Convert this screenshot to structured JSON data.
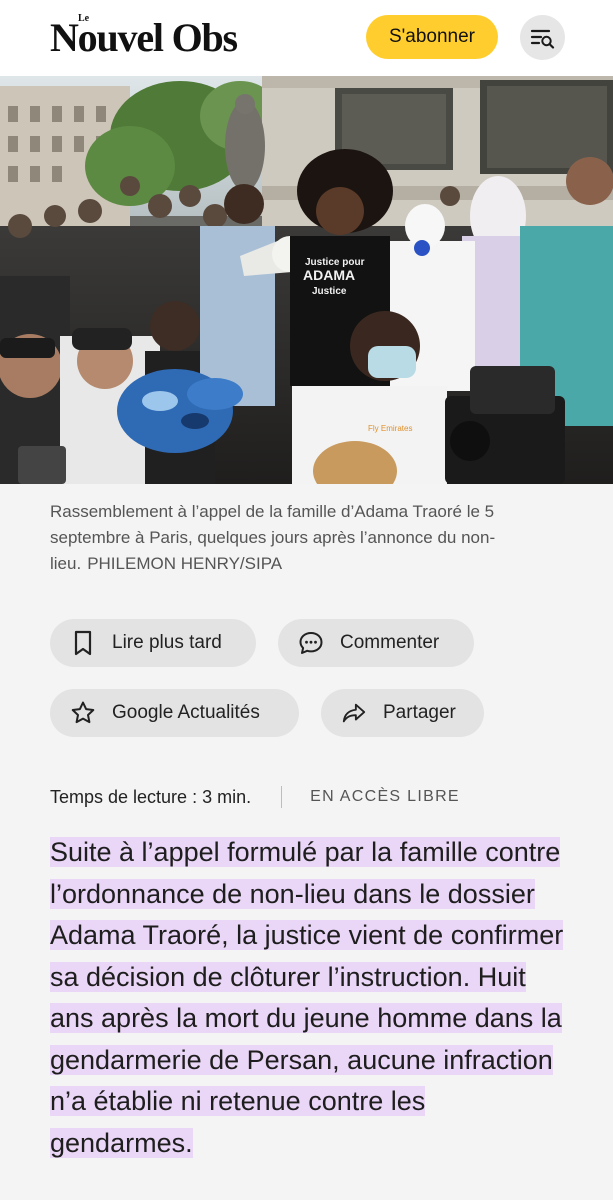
{
  "header": {
    "logo_small": "Le",
    "logo_main": "Nouvel Obs",
    "subscribe_label": "S'abonner",
    "menu_icon": "menu-search-icon",
    "subscribe_color": "#ffce2e"
  },
  "hero": {
    "sign_line1": "Justice pour",
    "sign_line2": "ADAMA",
    "sign_line3": "Justice",
    "jersey_text": "Fly Emirates"
  },
  "caption": {
    "text": "Rassemblement à l’appel de la famille d’Adama Traoré le 5 septembre à Paris, quelques jours après l’annonce du non-lieu.",
    "credit": "PHILEMON HENRY/SIPA"
  },
  "actions": {
    "read_later": {
      "label": "Lire plus tard",
      "icon": "bookmark-icon"
    },
    "comment": {
      "label": "Commenter",
      "icon": "comment-icon"
    },
    "google": {
      "label": "Google Actualités",
      "icon": "star-icon"
    },
    "share": {
      "label": "Partager",
      "icon": "share-icon"
    }
  },
  "meta": {
    "reading_time": "Temps de lecture : 3 min.",
    "access": "EN ACCÈS LIBRE"
  },
  "article": {
    "lede": "Suite à l’appel formulé par la famille contre l’ordonnance de non-lieu dans le dossier Adama Traoré, la justice vient de confirmer sa décision de clôturer l’instruction. Huit ans après la mort du jeune homme dans la gendarmerie de Persan, aucune infraction n’a établie ni retenue contre les gendarmes.",
    "highlight_color": "#ead6f6"
  }
}
